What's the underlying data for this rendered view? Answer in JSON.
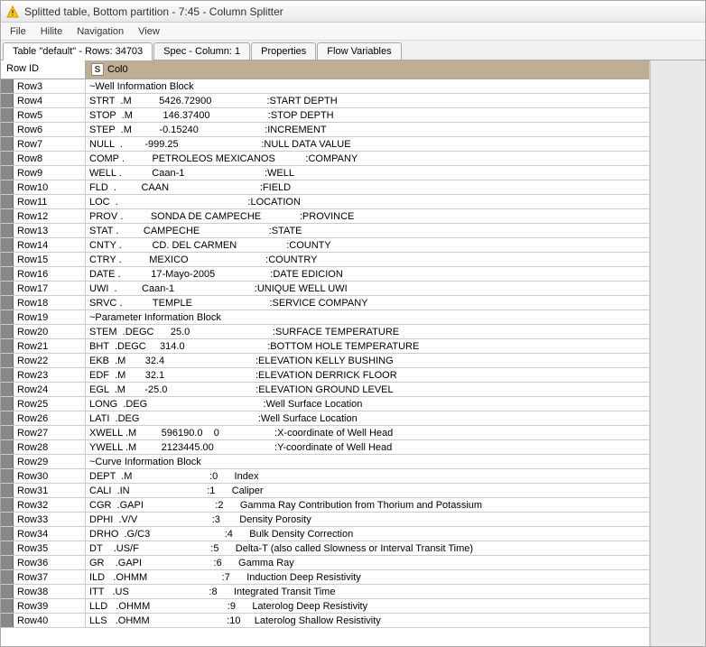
{
  "titlebar": {
    "text": "Splitted table, Bottom partition - 7:45 - Column Splitter"
  },
  "menubar": {
    "items": [
      "File",
      "Hilite",
      "Navigation",
      "View"
    ]
  },
  "tabs": {
    "items": [
      {
        "label": "Table \"default\" - Rows: 34703",
        "active": true
      },
      {
        "label": "Spec - Column: 1",
        "active": false
      },
      {
        "label": "Properties",
        "active": false
      },
      {
        "label": "Flow Variables",
        "active": false
      }
    ]
  },
  "table": {
    "headers": {
      "rowid": "Row ID",
      "col0": "Col0",
      "col0_type": "S"
    },
    "rows": [
      {
        "id": "Row3",
        "col0": "~Well Information Block"
      },
      {
        "id": "Row4",
        "col0": "STRT  .M          5426.72900                    :START DEPTH"
      },
      {
        "id": "Row5",
        "col0": "STOP  .M           146.37400                     :STOP DEPTH"
      },
      {
        "id": "Row6",
        "col0": "STEP  .M          -0.15240                        :INCREMENT"
      },
      {
        "id": "Row7",
        "col0": "NULL  .        -999.25                              :NULL DATA VALUE"
      },
      {
        "id": "Row8",
        "col0": "COMP .          PETROLEOS MEXICANOS           :COMPANY"
      },
      {
        "id": "Row9",
        "col0": "WELL .           Caan-1                             :WELL"
      },
      {
        "id": "Row10",
        "col0": "FLD  .         CAAN                                 :FIELD"
      },
      {
        "id": "Row11",
        "col0": "LOC  .                                               :LOCATION"
      },
      {
        "id": "Row12",
        "col0": "PROV .          SONDA DE CAMPECHE              :PROVINCE"
      },
      {
        "id": "Row13",
        "col0": "STAT .         CAMPECHE                         :STATE"
      },
      {
        "id": "Row14",
        "col0": "CNTY .           CD. DEL CARMEN                  :COUNTY"
      },
      {
        "id": "Row15",
        "col0": "CTRY .          MEXICO                            :COUNTRY"
      },
      {
        "id": "Row16",
        "col0": "DATE .           17-Mayo-2005                    :DATE EDICION"
      },
      {
        "id": "Row17",
        "col0": "UWI  .         Caan-1                             :UNIQUE WELL UWI"
      },
      {
        "id": "Row18",
        "col0": "SRVC .           TEMPLE                            :SERVICE COMPANY"
      },
      {
        "id": "Row19",
        "col0": "~Parameter Information Block"
      },
      {
        "id": "Row20",
        "col0": "STEM  .DEGC      25.0                              :SURFACE TEMPERATURE"
      },
      {
        "id": "Row21",
        "col0": "BHT  .DEGC     314.0                              :BOTTOM HOLE TEMPERATURE"
      },
      {
        "id": "Row22",
        "col0": "EKB  .M       32.4                                 :ELEVATION KELLY BUSHING"
      },
      {
        "id": "Row23",
        "col0": "EDF  .M       32.1                                 :ELEVATION DERRICK FLOOR"
      },
      {
        "id": "Row24",
        "col0": "EGL  .M       -25.0                                :ELEVATION GROUND LEVEL"
      },
      {
        "id": "Row25",
        "col0": "LONG  .DEG                                          :Well Surface Location"
      },
      {
        "id": "Row26",
        "col0": "LATI  .DEG                                           :Well Surface Location"
      },
      {
        "id": "Row27",
        "col0": "XWELL .M         596190.0    0                    :X-coordinate of Well Head"
      },
      {
        "id": "Row28",
        "col0": "YWELL .M         2123445.00                      :Y-coordinate of Well Head"
      },
      {
        "id": "Row29",
        "col0": "~Curve Information Block"
      },
      {
        "id": "Row30",
        "col0": "DEPT  .M                            :0      Index"
      },
      {
        "id": "Row31",
        "col0": "CALI  .IN                            :1      Caliper"
      },
      {
        "id": "Row32",
        "col0": "CGR  .GAPI                          :2      Gamma Ray Contribution from Thorium and Potassium"
      },
      {
        "id": "Row33",
        "col0": "DPHI  .V/V                           :3       Density Porosity"
      },
      {
        "id": "Row34",
        "col0": "DRHO  .G/C3                           :4      Bulk Density Correction"
      },
      {
        "id": "Row35",
        "col0": "DT    .US/F                          :5      Delta-T (also called Slowness or Interval Transit Time)"
      },
      {
        "id": "Row36",
        "col0": "GR    .GAPI                          :6      Gamma Ray"
      },
      {
        "id": "Row37",
        "col0": "ILD   .OHMM                           :7      Induction Deep Resistivity"
      },
      {
        "id": "Row38",
        "col0": "ITT   .US                             :8      Integrated Transit Time"
      },
      {
        "id": "Row39",
        "col0": "LLD   .OHMM                            :9      Laterolog Deep Resistivity"
      },
      {
        "id": "Row40",
        "col0": "LLS   .OHMM                            :10     Laterolog Shallow Resistivity"
      }
    ]
  }
}
